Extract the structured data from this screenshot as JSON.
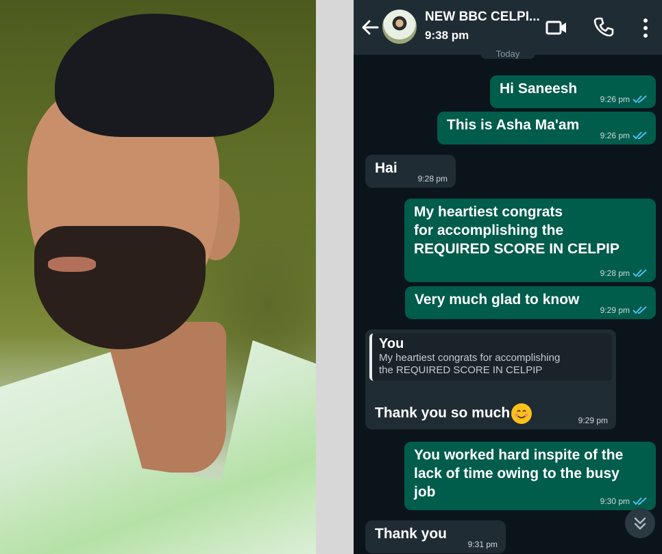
{
  "chat": {
    "title": "NEW BBC CELPI...",
    "time": "9:38 pm",
    "date_chip": "Today",
    "messages": [
      {
        "direction": "out",
        "text": "Hi  Saneesh",
        "time": "9:26 pm",
        "status": "read"
      },
      {
        "direction": "out",
        "text": "This is Asha Ma'am",
        "time": "9:26 pm",
        "status": "read"
      },
      {
        "direction": "in",
        "text": "Hai",
        "time": "9:28 pm"
      },
      {
        "direction": "out",
        "text": "My heartiest  congrats\nfor  accomplishing  the\nREQUIRED  SCORE IN CELPIP",
        "time": "9:28 pm",
        "status": "read"
      },
      {
        "direction": "out",
        "text": "Very much glad to know",
        "time": "9:29 pm",
        "status": "read"
      },
      {
        "direction": "in",
        "quote_author": "You",
        "quote_text": "My heartiest  congrats  for  accomplishing\nthe      REQUIRED  SCORE IN CELPIP",
        "text": "Thank  you so much",
        "emoji": "smiling-face-emoji",
        "time": "9:29 pm"
      },
      {
        "direction": "out",
        "text": "You worked hard inspite of the\nlack of time owing to the busy\njob",
        "time": "9:30 pm",
        "status": "read"
      },
      {
        "direction": "in",
        "text": "Thank you",
        "time": "9:31 pm"
      }
    ]
  },
  "colors": {
    "header_bg": "#1f2c34",
    "chat_bg": "#0b141a",
    "outgoing_bubble": "#005c4b",
    "incoming_bubble": "#202c33",
    "read_tick": "#53bdeb"
  },
  "icons": [
    "back-arrow-icon",
    "video-call-icon",
    "voice-call-icon",
    "more-options-icon",
    "read-receipt-icon",
    "scroll-down-icon"
  ]
}
